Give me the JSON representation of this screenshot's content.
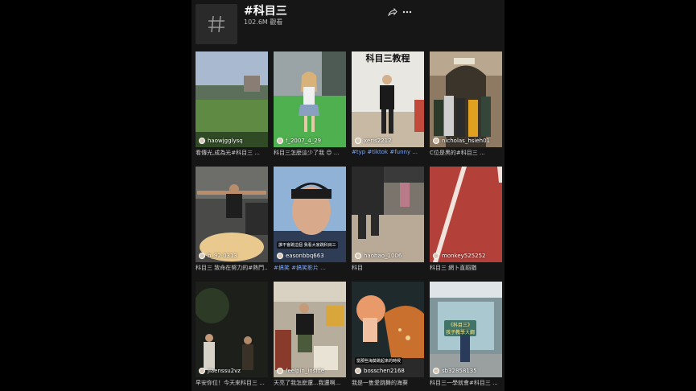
{
  "header": {
    "title": "#科目三",
    "views": "102.6M 觀看"
  },
  "cards": [
    {
      "user": "haowjgglysq",
      "caption": "看傳光,成為光#科目三 ...",
      "caption_hl": ""
    },
    {
      "user": "f_2007_4_29",
      "caption": "科目三怎麼這少了我 😊 ...",
      "caption_hl": ""
    },
    {
      "user": "xeris2212",
      "caption": "",
      "caption_hl": "#typ #tiktok #funny ...",
      "overlay": "科目三教程"
    },
    {
      "user": "nicholas_hsieh01",
      "caption": "C位是黑的#科目三 ...",
      "caption_hl": ""
    },
    {
      "user": "b_92.0313",
      "caption": "科目三 致命在努力的#熱門...",
      "caption_hl": ""
    },
    {
      "user": "easonbbq663",
      "caption": "",
      "caption_hl": "#搞笑 #搞笑影片 ...",
      "pill": "誰不會跳這個 我看大家跳科目三"
    },
    {
      "user": "haohao_1006",
      "caption": "科目",
      "caption_hl": ""
    },
    {
      "user": "monkey525252",
      "caption": "科目三 網卜直蹈猶",
      "caption_hl": ""
    },
    {
      "user": "jiaenssu2vz",
      "caption": "早安你位！今天來科目三 ...",
      "caption_hl": ""
    },
    {
      "user": "feelpin_inside",
      "caption": "天亮了我怎麼還...我還啊...",
      "caption_hl": ""
    },
    {
      "user": "bosschen2168",
      "caption": "我是一隻愛跳舞的海葵",
      "caption_hl": "",
      "pill": "當那些海葵跳起來的時候"
    },
    {
      "user": "sb32858135",
      "caption": "科目三一學就會#科目三 ...",
      "caption_hl": "",
      "overlay2": "《科目三》\n孩子教學大綱"
    }
  ]
}
